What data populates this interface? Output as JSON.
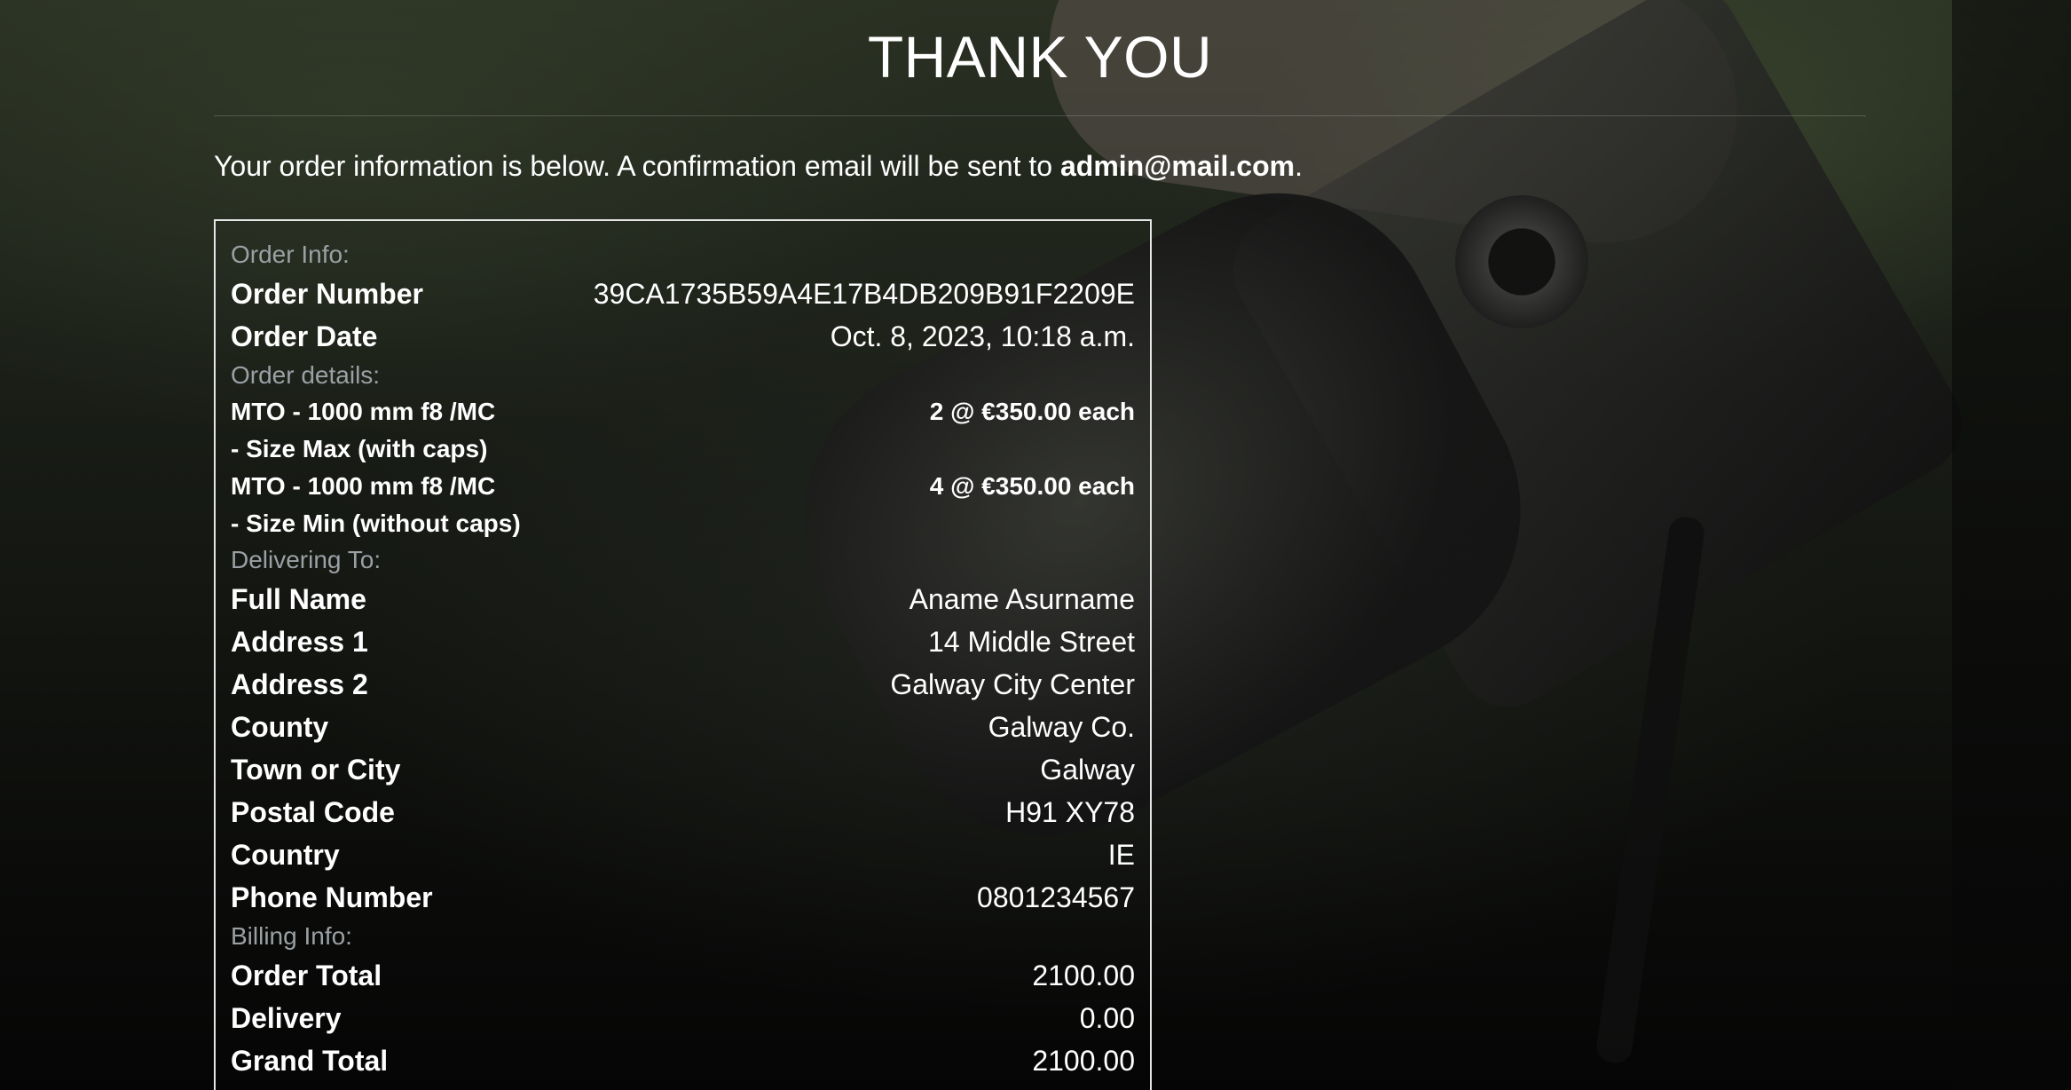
{
  "page": {
    "title": "THANK YOU",
    "intro_text": "Your order information is below. A confirmation email will be sent to ",
    "email": "admin@mail.com",
    "intro_end": "."
  },
  "order_info": {
    "section_label": "Order Info:",
    "order_number_label": "Order Number",
    "order_number_value": "39CA1735B59A4E17B4DB209B91F2209E",
    "order_date_label": "Order Date",
    "order_date_value": "Oct. 8, 2023, 10:18 a.m."
  },
  "order_details": {
    "section_label": "Order details:",
    "items": [
      {
        "name_line1": "MTO - 1000 mm f8 /MC",
        "name_line2": "- Size Max (with caps)",
        "qty": "2 @ €350.00 each"
      },
      {
        "name_line1": "MTO - 1000 mm f8 /MC",
        "name_line2": "- Size Min (without caps)",
        "qty": "4 @ €350.00 each"
      }
    ]
  },
  "delivery": {
    "section_label": "Delivering To:",
    "rows": [
      {
        "label": "Full Name",
        "value": "Aname Asurname"
      },
      {
        "label": "Address 1",
        "value": "14 Middle Street"
      },
      {
        "label": "Address 2",
        "value": "Galway City Center"
      },
      {
        "label": "County",
        "value": "Galway Co."
      },
      {
        "label": "Town or City",
        "value": "Galway"
      },
      {
        "label": "Postal Code",
        "value": "H91 XY78"
      },
      {
        "label": "Country",
        "value": "IE"
      },
      {
        "label": "Phone Number",
        "value": "0801234567"
      }
    ]
  },
  "billing": {
    "section_label": "Billing Info:",
    "rows": [
      {
        "label": "Order Total",
        "value": "2100.00"
      },
      {
        "label": "Delivery",
        "value": "0.00"
      },
      {
        "label": "Grand Total",
        "value": "2100.00"
      }
    ]
  }
}
